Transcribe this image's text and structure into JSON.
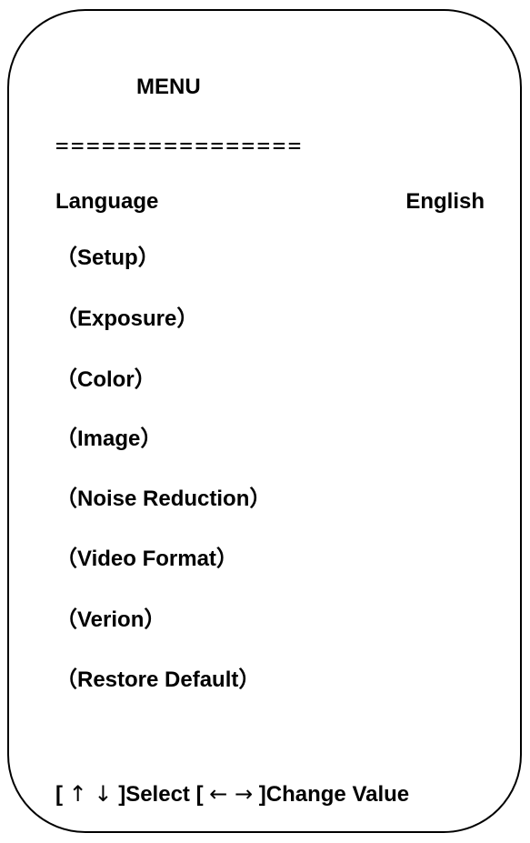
{
  "menu": {
    "title": "MENU",
    "divider": "================",
    "language": {
      "label": "Language",
      "value": "English"
    },
    "items": [
      {
        "label": "（Setup）"
      },
      {
        "label": "（Exposure）"
      },
      {
        "label": "（Color）"
      },
      {
        "label": "（Image）"
      },
      {
        "label": "（Noise Reduction）"
      },
      {
        "label": "（Video Format）"
      },
      {
        "label": "（Verion）"
      },
      {
        "label": "（Restore Default）"
      }
    ]
  },
  "footer": {
    "open_bracket_1": "[",
    "nav_arrows": "↑ ↓",
    "select_text": "]Select [",
    "change_arrows": "← →",
    "change_text": "]Change Value"
  }
}
